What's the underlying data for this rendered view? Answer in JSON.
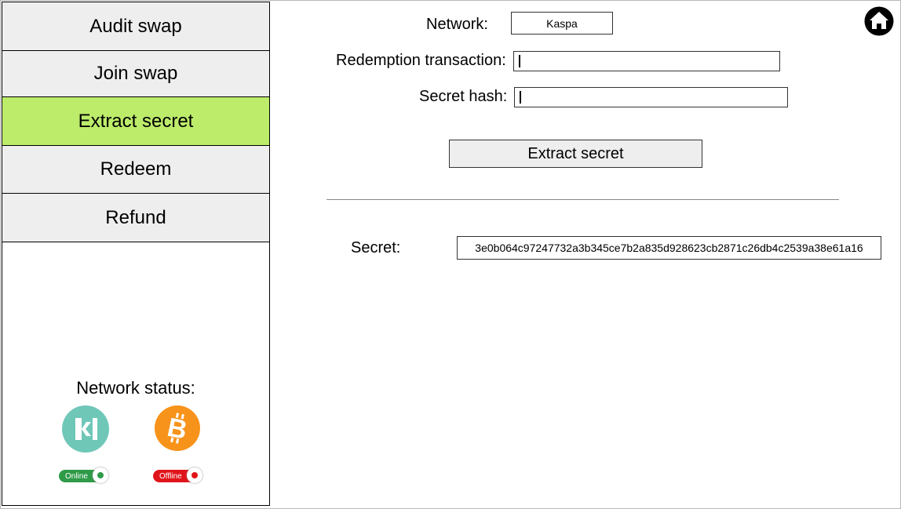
{
  "sidebar": {
    "items": [
      {
        "label": "Audit swap",
        "active": false
      },
      {
        "label": "Join swap",
        "active": false
      },
      {
        "label": "Extract secret",
        "active": true
      },
      {
        "label": "Redeem",
        "active": false
      },
      {
        "label": "Refund",
        "active": false
      }
    ],
    "status_title": "Network status:",
    "networks": [
      {
        "icon": "kaspa-icon",
        "status": "Online",
        "color": "#6fc7b8"
      },
      {
        "icon": "bitcoin-icon",
        "status": "Offline",
        "color": "#f7931a"
      }
    ]
  },
  "form": {
    "network_label": "Network:",
    "network_value": "Kaspa",
    "redemption_label": "Redemption transaction:",
    "redemption_value": "",
    "secret_hash_label": "Secret hash:",
    "secret_hash_value": "",
    "extract_button": "Extract secret"
  },
  "result": {
    "secret_label": "Secret:",
    "secret_value": "3e0b064c97247732a3b345ce7b2a835d928623cb2871c26db4c2539a38e61a16"
  },
  "colors": {
    "active_nav": "#bdec6b",
    "online": "#2f9a48",
    "offline": "#e0151b"
  }
}
